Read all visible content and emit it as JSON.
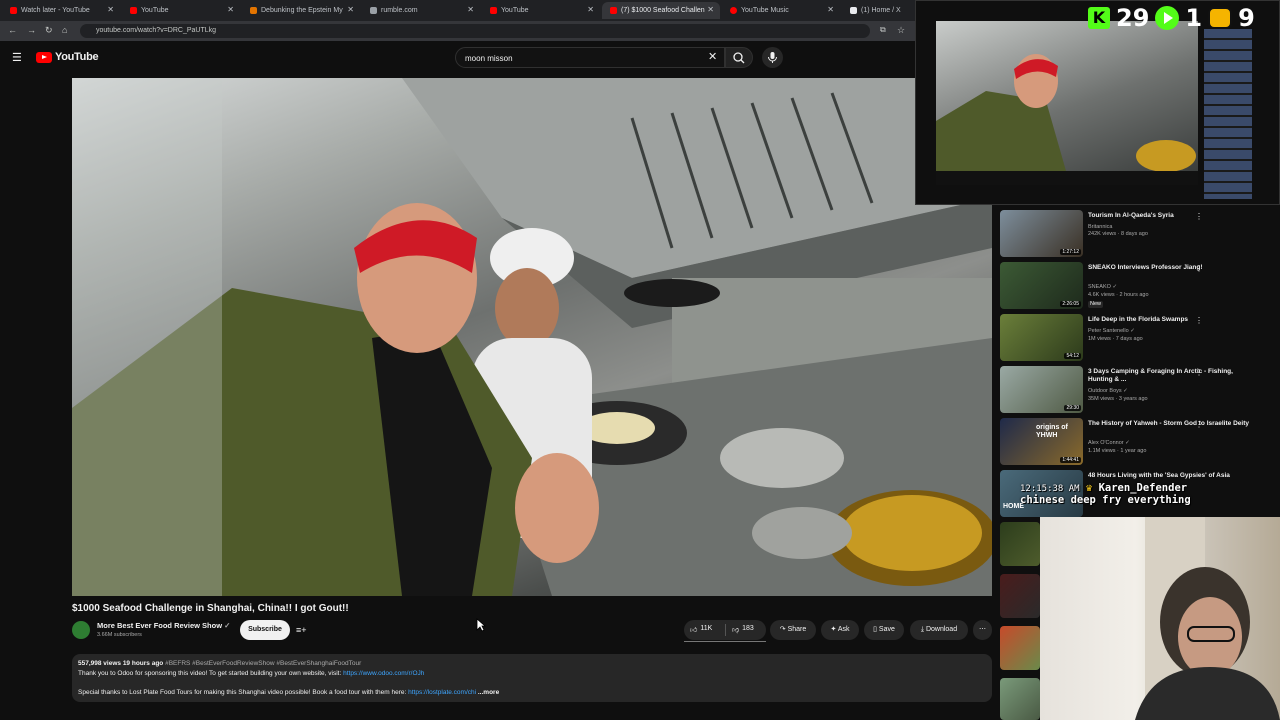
{
  "browser": {
    "tabs": [
      {
        "title": "Watch later - YouTube",
        "favicon": "#ff0000"
      },
      {
        "title": "YouTube",
        "favicon": "#ff0000"
      },
      {
        "title": "Debunking the Epstein My",
        "favicon": "#e37400"
      },
      {
        "title": "rumble.com",
        "favicon": "#9aa0a6"
      },
      {
        "title": "YouTube",
        "favicon": "#ff0000"
      },
      {
        "title": "(7) $1000 Seafood Challen",
        "favicon": "#ff0000"
      },
      {
        "title": "YouTube Music",
        "favicon": "#ff0000"
      },
      {
        "title": "(1) Home / X",
        "favicon": "#e8eaed"
      }
    ],
    "url": "youtube.com/watch?v=DRC_PaUTLkg"
  },
  "youtube": {
    "logo_text": "YouTube",
    "search_value": "moon misson"
  },
  "video": {
    "title": "$1000 Seafood Challenge in Shanghai, China!! I got Gout!!",
    "channel": "More Best Ever Food Review Show",
    "subscribers": "3.66M subscribers",
    "subscribe_label": "Subscribe",
    "likes": "11K",
    "dislikes": "183",
    "share_label": "Share",
    "ask_label": "Ask",
    "save_label": "Save",
    "download_label": "Download",
    "stats": "557,998 views  19 hours ago",
    "hashtags": "#BEFRS #BestEverFoodReviewShow #BestEverShanghaiFoodTour",
    "desc_line1": "Thank you to Odoo for sponsoring this video! To get started building your own website, visit: ",
    "desc_link1": "https://www.odoo.com/r/OJh",
    "desc_line2": "Special thanks to Lost Plate Food Tours for making this Shanghai video possible! Book a food tour with them here: ",
    "desc_link2": "https://lostplate.com/chi",
    "more_label": "...more"
  },
  "recommendations": [
    {
      "title": "Tourism In Al-Qaeda's Syria",
      "channel": "Britannica",
      "meta": "242K views · 8 days ago",
      "duration": "1:27:12",
      "colors": [
        "#7d8e9c",
        "#3a3024"
      ]
    },
    {
      "title": "SNEAKO Interviews Professor Jiang!",
      "channel": "SNEAKO",
      "meta": "4.6K views · 2 hours ago",
      "badge": "New",
      "duration": "2:26:05",
      "colors": [
        "#3c5a35",
        "#1e2a1c"
      ]
    },
    {
      "title": "Life Deep in the Florida Swamps",
      "channel": "Peter Santenello",
      "meta": "1M views · 7 days ago",
      "duration": "54:12",
      "colors": [
        "#6b7f3a",
        "#2c3a1b"
      ]
    },
    {
      "title": "3 Days Camping & Foraging In Arctic - Fishing, Hunting & ...",
      "channel": "Outdoor Boys",
      "meta": "35M views · 3 years ago",
      "duration": "29:30",
      "colors": [
        "#9aa9a4",
        "#4f5a44"
      ]
    },
    {
      "title": "The History of Yahweh - Storm God to Israelite Deity",
      "channel": "Alex O'Connor",
      "meta": "1.1M views · 1 year ago",
      "duration": "1:44:41",
      "overlay": "origins of YHWH",
      "colors": [
        "#1f2a4a",
        "#8a6a2a"
      ]
    },
    {
      "title": "48 Hours Living with the 'Sea Gypsies' of Asia",
      "channel": "",
      "meta": "",
      "duration": "",
      "overlay": "HOME",
      "colors": [
        "#4a6a7a",
        "#283a44"
      ]
    }
  ],
  "overlay": {
    "hud_numbers": [
      "29",
      "1",
      "9"
    ],
    "chat_time": "12:15:38 AM",
    "chat_user": "Karen_Defender",
    "chat_message": "chinese deep fry everything"
  }
}
